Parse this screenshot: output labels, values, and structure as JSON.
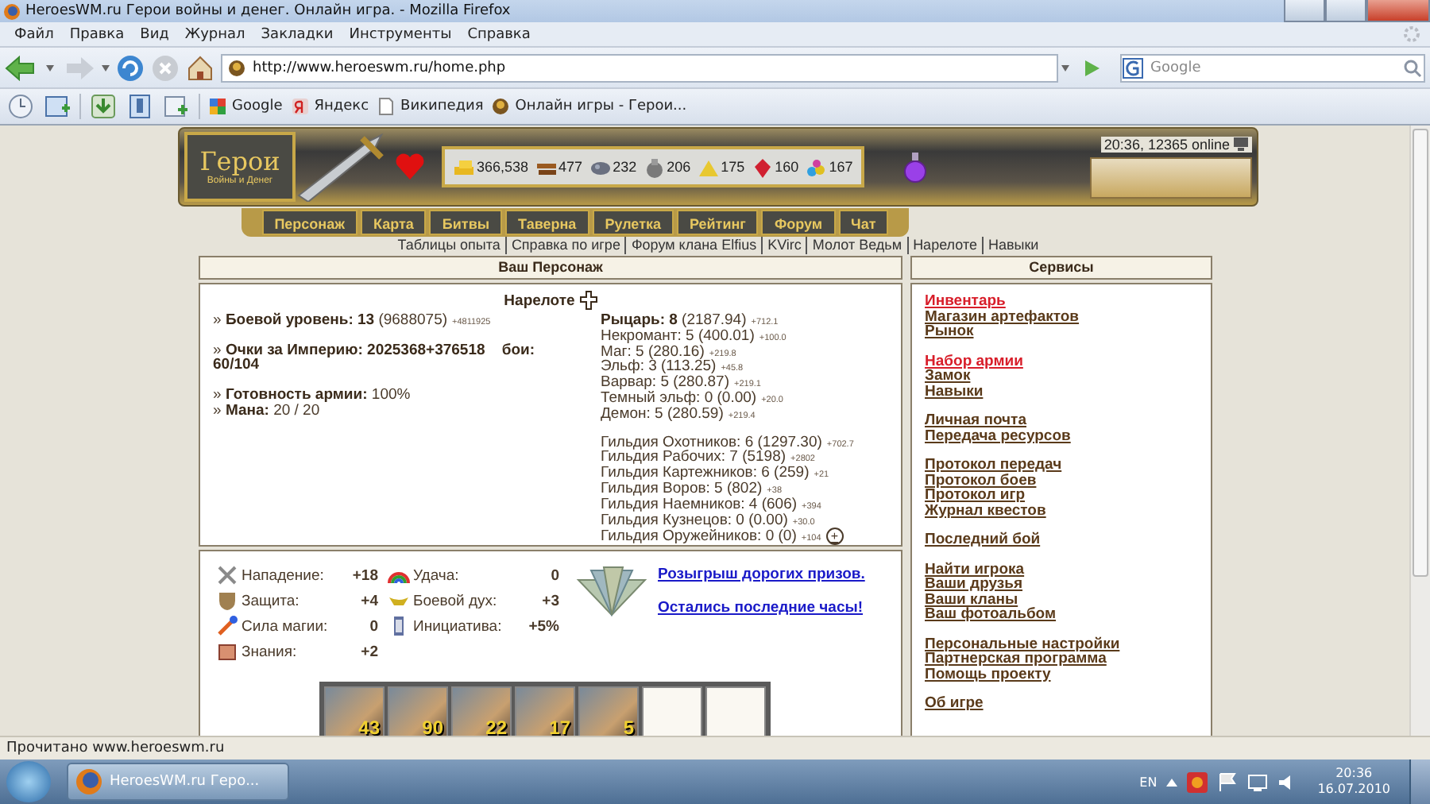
{
  "browser": {
    "title": "HeroesWM.ru Герои войны и денег. Онлайн игра. - Mozilla Firefox",
    "menu": [
      "Файл",
      "Правка",
      "Вид",
      "Журнал",
      "Закладки",
      "Инструменты",
      "Справка"
    ],
    "url": "http://www.heroeswm.ru/home.php",
    "search_placeholder": "Google",
    "bookmarks": [
      "Google",
      "Яндекс",
      "Википедия",
      "Онлайн игры - Герои..."
    ],
    "status": "Прочитано www.heroeswm.ru"
  },
  "game": {
    "logo_title": "Герои",
    "logo_subtitle": "Войны и Денег",
    "resources": [
      "366,538",
      "477",
      "232",
      "206",
      "175",
      "160",
      "167"
    ],
    "online": "20:36, 12365 online",
    "tabs": [
      "Персонаж",
      "Карта",
      "Битвы",
      "Таверна",
      "Рулетка",
      "Рейтинг",
      "Форум",
      "Чат"
    ],
    "links": [
      "Таблицы опыта",
      "Справка по игре",
      "Форум клана Elfius",
      "KVirc",
      "Молот Ведьм",
      "Нарелоте",
      "Навыки"
    ]
  },
  "character": {
    "header": "Ваш Персонаж",
    "name": "Нарелоте",
    "stats": [
      [
        {
          "text": "» **Боевой уровень: 13** (9688075)",
          "gain": "+4811925"
        }
      ],
      [
        {
          "text": "» **Очки за Империю: 2025368+376518    бои: 60/104**"
        }
      ],
      [
        {
          "text": "» **Готовность армии:** 100%"
        },
        {
          "text": "» **Мана:** 20 / 20"
        }
      ]
    ],
    "factions": [
      [
        {
          "text": "**Рыцарь: 8** (2187.94)",
          "gain": "+712.1"
        },
        {
          "text": "Некромант: 5 (400.01)",
          "gain": "+100.0"
        },
        {
          "text": "Маг: 5 (280.16)",
          "gain": "+219.8"
        },
        {
          "text": "Эльф: 3 (113.25)",
          "gain": "+45.8"
        },
        {
          "text": "Варвар: 5 (280.87)",
          "gain": "+219.1"
        },
        {
          "text": "Темный эльф: 0 (0.00)",
          "gain": "+20.0"
        },
        {
          "text": "Демон: 5 (280.59)",
          "gain": "+219.4"
        }
      ],
      [
        {
          "text": "Гильдия Охотников: 6 (1297.30)",
          "gain": "+702.7"
        },
        {
          "text": "Гильдия Рабочих: 7 (5198)",
          "gain": "+2802"
        },
        {
          "text": "Гильдия Картежников: 6 (259)",
          "gain": "+21"
        },
        {
          "text": "Гильдия Воров: 5 (802)",
          "gain": "+38"
        },
        {
          "text": "Гильдия Наемников: 4 (606)",
          "gain": "+394"
        },
        {
          "text": "Гильдия Кузнецов: 0 (0.00)",
          "gain": "+30.0"
        },
        {
          "text": "Гильдия Оружейников: 0 (0)",
          "gain": "+104",
          "action": "+"
        }
      ]
    ],
    "skills": [
      [
        {
          "label": "Нападение:",
          "value": "+18"
        },
        {
          "label": "Защита:",
          "value": "+4"
        },
        {
          "label": "Сила магии:",
          "value": "0"
        },
        {
          "label": "Знания:",
          "value": "+2"
        }
      ],
      [
        {
          "label": "Удача:",
          "value": "0"
        },
        {
          "label": "Боевой дух:",
          "value": "+3"
        },
        {
          "label": "Инициатива:",
          "value": "+5%"
        }
      ]
    ],
    "promo": [
      "Розыгрыш дорогих призов.",
      "Остались последние часы!"
    ],
    "army": [
      {
        "kind": "unit",
        "count": "43"
      },
      {
        "kind": "unit",
        "count": "90"
      },
      {
        "kind": "unit",
        "count": "22"
      },
      {
        "kind": "unit",
        "count": "17"
      },
      {
        "kind": "unit",
        "count": "5"
      },
      {
        "kind": "empty"
      },
      {
        "kind": "empty"
      }
    ]
  },
  "services": {
    "header": "Сервисы",
    "groups": [
      [
        {
          "label": "Инвентарь",
          "highlight": true
        },
        {
          "label": "Магазин артефактов",
          "highlight": false
        },
        {
          "label": "Рынок",
          "highlight": false
        }
      ],
      [
        {
          "label": "Набор армии",
          "highlight": true
        },
        {
          "label": "Замок",
          "highlight": false
        },
        {
          "label": "Навыки",
          "highlight": false
        }
      ],
      [
        {
          "label": "Личная почта",
          "highlight": false
        },
        {
          "label": "Передача ресурсов",
          "highlight": false
        }
      ],
      [
        {
          "label": "Протокол передач",
          "highlight": false
        },
        {
          "label": "Протокол боев",
          "highlight": false
        },
        {
          "label": "Протокол игр",
          "highlight": false
        },
        {
          "label": "Журнал квестов",
          "highlight": false
        }
      ],
      [
        {
          "label": "Последний бой",
          "highlight": false
        }
      ],
      [
        {
          "label": "Найти игрока",
          "highlight": false
        },
        {
          "label": "Ваши друзья",
          "highlight": false
        },
        {
          "label": "Ваши кланы",
          "highlight": false
        },
        {
          "label": "Ваш фотоальбом",
          "highlight": false
        }
      ],
      [
        {
          "label": "Персональные настройки",
          "highlight": false
        },
        {
          "label": "Партнерская программа",
          "highlight": false
        },
        {
          "label": "Помощь проекту",
          "highlight": false
        }
      ],
      [
        {
          "label": "Об игре",
          "highlight": false
        }
      ]
    ]
  },
  "taskbar": {
    "task": "HeroesWM.ru Геро...",
    "language": "EN",
    "time": "20:36",
    "date": "16.07.2010"
  }
}
